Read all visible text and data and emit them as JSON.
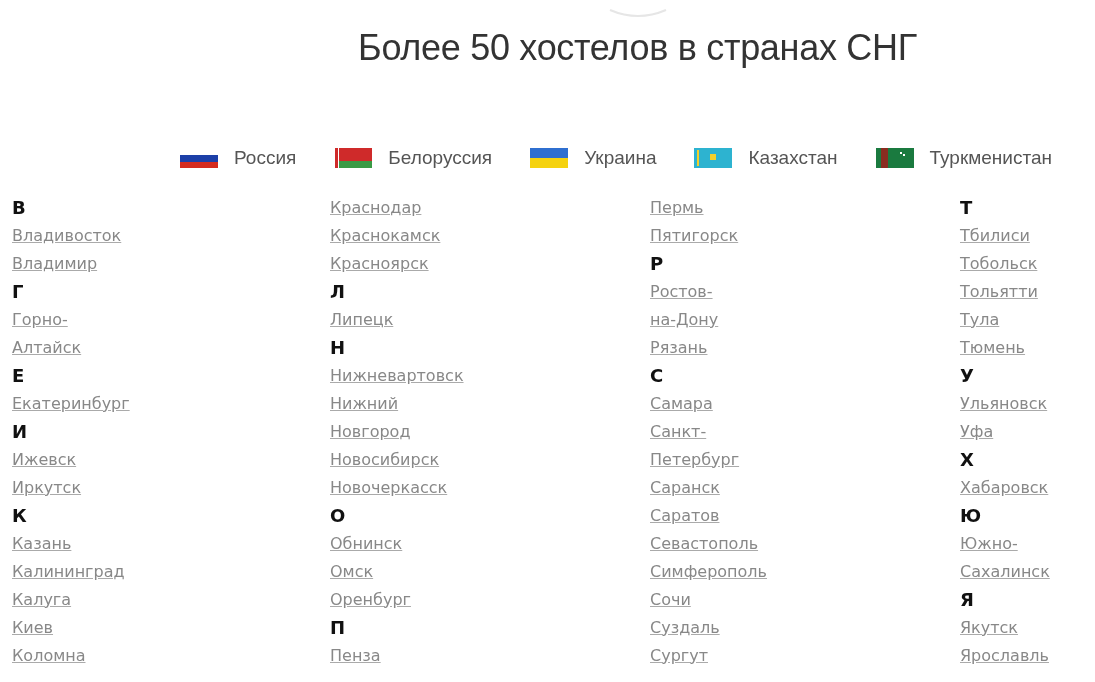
{
  "title": "Более 50 хостелов в странах СНГ",
  "countries": [
    {
      "name": "Россия",
      "kind": "russia"
    },
    {
      "name": "Белоруссия",
      "kind": "belarus"
    },
    {
      "name": "Украина",
      "kind": "ukraine"
    },
    {
      "name": "Казахстан",
      "kind": "kazakhstan"
    },
    {
      "name": "Туркменистан",
      "kind": "turkmenistan"
    }
  ],
  "columns": [
    [
      {
        "kind": "letter",
        "text": "В"
      },
      {
        "kind": "city",
        "text": "Владивосток"
      },
      {
        "kind": "city",
        "text": "Владимир"
      },
      {
        "kind": "letter",
        "text": "Г"
      },
      {
        "kind": "city",
        "text": "Горно-"
      },
      {
        "kind": "city",
        "text": "Алтайск"
      },
      {
        "kind": "letter",
        "text": "Е"
      },
      {
        "kind": "city",
        "text": "Екатеринбург"
      },
      {
        "kind": "letter",
        "text": "И"
      },
      {
        "kind": "city",
        "text": "Ижевск"
      },
      {
        "kind": "city",
        "text": "Иркутск"
      },
      {
        "kind": "letter",
        "text": "К"
      },
      {
        "kind": "city",
        "text": "Казань"
      },
      {
        "kind": "city",
        "text": "Калининград"
      },
      {
        "kind": "city",
        "text": "Калуга"
      },
      {
        "kind": "city",
        "text": "Киев"
      },
      {
        "kind": "city",
        "text": "Коломна"
      }
    ],
    [
      {
        "kind": "city",
        "text": "Краснодар"
      },
      {
        "kind": "city",
        "text": "Краснокамск"
      },
      {
        "kind": "city",
        "text": "Красноярск"
      },
      {
        "kind": "letter",
        "text": "Л"
      },
      {
        "kind": "city",
        "text": "Липецк"
      },
      {
        "kind": "letter",
        "text": "Н"
      },
      {
        "kind": "city",
        "text": "Нижневартовск"
      },
      {
        "kind": "city",
        "text": "Нижний"
      },
      {
        "kind": "city",
        "text": "Новгород"
      },
      {
        "kind": "city",
        "text": "Новосибирск"
      },
      {
        "kind": "city",
        "text": "Новочеркасск"
      },
      {
        "kind": "letter",
        "text": "О"
      },
      {
        "kind": "city",
        "text": "Обнинск"
      },
      {
        "kind": "city",
        "text": "Омск"
      },
      {
        "kind": "city",
        "text": "Оренбург"
      },
      {
        "kind": "letter",
        "text": "П"
      },
      {
        "kind": "city",
        "text": "Пенза"
      }
    ],
    [
      {
        "kind": "city",
        "text": "Пермь"
      },
      {
        "kind": "city",
        "text": "Пятигорск"
      },
      {
        "kind": "letter",
        "text": "Р"
      },
      {
        "kind": "city",
        "text": "Ростов-"
      },
      {
        "kind": "city",
        "text": "на-Дону"
      },
      {
        "kind": "city",
        "text": "Рязань"
      },
      {
        "kind": "letter",
        "text": "С"
      },
      {
        "kind": "city",
        "text": "Самара"
      },
      {
        "kind": "city",
        "text": "Санкт-"
      },
      {
        "kind": "city",
        "text": "Петербург"
      },
      {
        "kind": "city",
        "text": "Саранск"
      },
      {
        "kind": "city",
        "text": "Саратов"
      },
      {
        "kind": "city",
        "text": "Севастополь"
      },
      {
        "kind": "city",
        "text": "Симферополь"
      },
      {
        "kind": "city",
        "text": "Сочи"
      },
      {
        "kind": "city",
        "text": "Суздаль"
      },
      {
        "kind": "city",
        "text": "Сургут"
      }
    ],
    [
      {
        "kind": "letter",
        "text": "Т"
      },
      {
        "kind": "city",
        "text": "Тбилиси"
      },
      {
        "kind": "city",
        "text": "Тобольск"
      },
      {
        "kind": "city",
        "text": "Тольятти"
      },
      {
        "kind": "city",
        "text": "Тула"
      },
      {
        "kind": "city",
        "text": "Тюмень"
      },
      {
        "kind": "letter",
        "text": "У"
      },
      {
        "kind": "city",
        "text": "Ульяновск"
      },
      {
        "kind": "city",
        "text": "Уфа"
      },
      {
        "kind": "letter",
        "text": "Х"
      },
      {
        "kind": "city",
        "text": "Хабаровск"
      },
      {
        "kind": "letter",
        "text": "Ю"
      },
      {
        "kind": "city",
        "text": "Южно-"
      },
      {
        "kind": "city",
        "text": "Сахалинск"
      },
      {
        "kind": "letter",
        "text": "Я"
      },
      {
        "kind": "city",
        "text": "Якутск"
      },
      {
        "kind": "city",
        "text": "Ярославль"
      }
    ]
  ]
}
